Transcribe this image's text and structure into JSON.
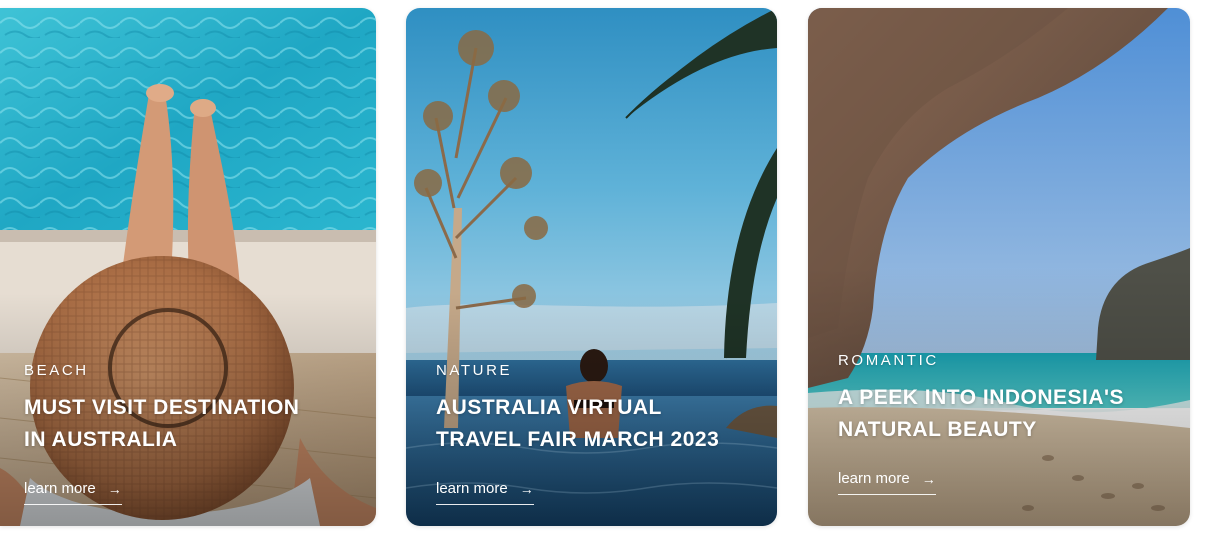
{
  "cards": [
    {
      "category": "BEACH",
      "title_line1": "MUST VISIT DESTINATION",
      "title_line2": "IN AUSTRALIA",
      "link": "learn more",
      "arrow": "→"
    },
    {
      "category": "NATURE",
      "title_line1": "AUSTRALIA VIRTUAL",
      "title_line2": "TRAVEL FAIR MARCH 2023",
      "link": "learn more",
      "arrow": "→"
    },
    {
      "category": "ROMANTIC",
      "title_line1": "A PEEK INTO INDONESIA'S",
      "title_line2": "NATURAL BEAUTY",
      "link": "learn more",
      "arrow": "→"
    }
  ]
}
